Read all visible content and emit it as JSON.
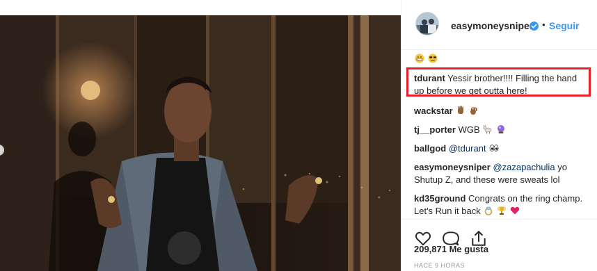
{
  "post": {
    "username": "easymoneysniper",
    "separator": "•",
    "follow_label": "Seguir",
    "likes": "209,871 Me gusta",
    "time": "HACE 9 HORAS"
  },
  "comments": [
    {
      "user": "",
      "text": "",
      "emojis": [
        "grinning-face-emoji",
        "sunglasses-face-emoji"
      ]
    },
    {
      "user": "tdurant",
      "text": "Yessir brother!!!! Filling the hand",
      "text2": "up before we get outta here!"
    },
    {
      "user": "wackstar",
      "text": "",
      "emojis": [
        "raised-hand-emoji",
        "ok-hand-emoji"
      ]
    },
    {
      "user": "tj__porter",
      "text": "WGB",
      "emojis": [
        "goat-emoji",
        "crystal-ball-emoji"
      ]
    },
    {
      "user": "ballgod",
      "mention": "@tdurant",
      "emojis": [
        "eyes-emoji"
      ]
    },
    {
      "user": "easymoneysniper",
      "mention": "@zazapachulia",
      "text": "yo",
      "text2": "Shutup Z, and these were sweats lol"
    },
    {
      "user": "kd35ground",
      "text": "Congrats on the ring champ.",
      "text2": "Let's Run it back",
      "emojis": [
        "ring-emoji",
        "trophy-emoji",
        "red-heart-emoji"
      ]
    }
  ],
  "colors": {
    "link": "#3897f0",
    "text": "#262626",
    "highlight": "#e8222b",
    "muted": "#999999"
  }
}
